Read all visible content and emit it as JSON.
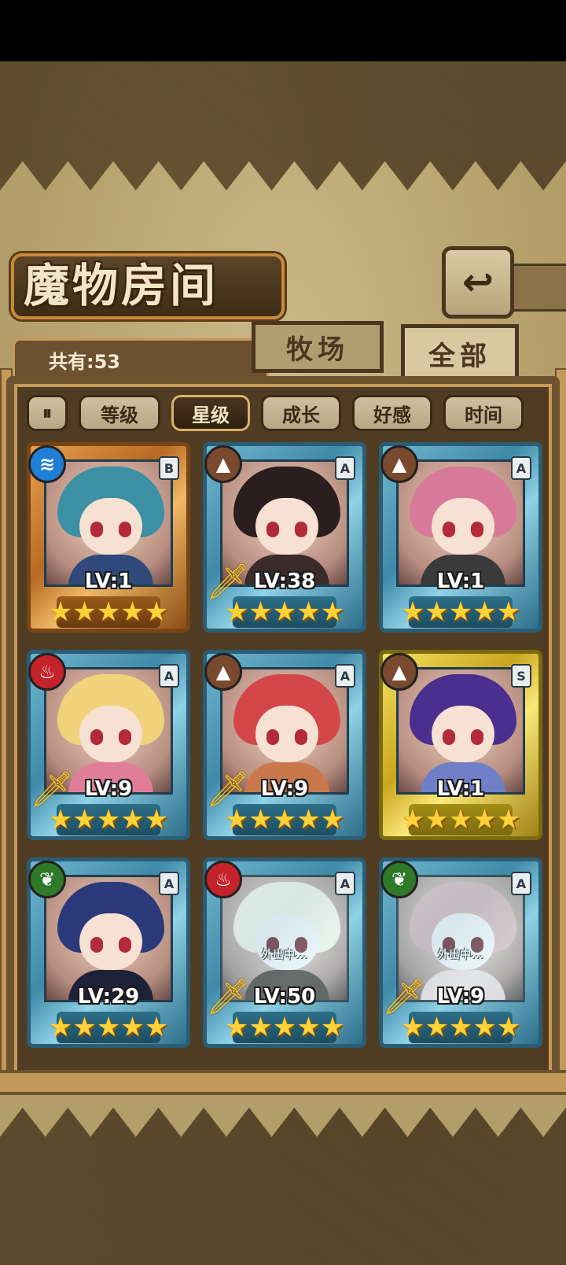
{
  "header": {
    "title": "魔物房间",
    "back_icon": "back-arrow-icon"
  },
  "summary": {
    "count_label": "共有:53"
  },
  "tabs": [
    {
      "label": "牧场",
      "active": false
    },
    {
      "label": "全部",
      "active": true
    }
  ],
  "filters": {
    "toggle_icon": "sort-toggle-icon",
    "buttons": [
      {
        "label": "等级",
        "selected": false
      },
      {
        "label": "星级",
        "selected": true
      },
      {
        "label": "成长",
        "selected": false
      },
      {
        "label": "好感",
        "selected": false
      },
      {
        "label": "时间",
        "selected": false
      }
    ]
  },
  "monsters": [
    {
      "level": "LV:1",
      "rank": "B",
      "element": "water",
      "element_color": "#1f7fd6",
      "frame": "orange",
      "stars": 5,
      "weapon": false,
      "away": false,
      "hair": "#3d8fa3",
      "outfit": "#2f4a7a"
    },
    {
      "level": "LV:38",
      "rank": "A",
      "element": "earth",
      "element_color": "#7a4a2e",
      "frame": "blue",
      "stars": 5,
      "weapon": true,
      "away": false,
      "hair": "#2a1e1e",
      "outfit": "#3b2a2a"
    },
    {
      "level": "LV:1",
      "rank": "A",
      "element": "earth",
      "element_color": "#7a4a2e",
      "frame": "blue",
      "stars": 5,
      "weapon": false,
      "away": false,
      "hair": "#d77a9a",
      "outfit": "#3a3a3a"
    },
    {
      "level": "LV:9",
      "rank": "A",
      "element": "fire",
      "element_color": "#c5232b",
      "frame": "blue",
      "stars": 5,
      "weapon": true,
      "away": false,
      "hair": "#f0d37a",
      "outfit": "#e07e9a"
    },
    {
      "level": "LV:9",
      "rank": "A",
      "element": "earth",
      "element_color": "#7a4a2e",
      "frame": "blue",
      "stars": 5,
      "weapon": true,
      "away": false,
      "hair": "#d3474a",
      "outfit": "#c8784a"
    },
    {
      "level": "LV:1",
      "rank": "S",
      "element": "earth",
      "element_color": "#7a4a2e",
      "frame": "gold",
      "stars": 5,
      "weapon": false,
      "away": false,
      "hair": "#4a2f8e",
      "outfit": "#6f7fc8"
    },
    {
      "level": "LV:29",
      "rank": "A",
      "element": "nature",
      "element_color": "#2f7a2a",
      "frame": "blue",
      "stars": 5,
      "weapon": false,
      "away": false,
      "hair": "#2a3a7a",
      "outfit": "#1e2238"
    },
    {
      "level": "LV:50",
      "rank": "A",
      "element": "fire",
      "element_color": "#c5232b",
      "frame": "blue",
      "stars": 5,
      "weapon": true,
      "away": true,
      "away_label": "外出中...",
      "hair": "#e8dcc0",
      "outfit": "#5a4a3a"
    },
    {
      "level": "LV:9",
      "rank": "A",
      "element": "nature",
      "element_color": "#2f7a2a",
      "frame": "blue",
      "stars": 5,
      "weapon": true,
      "away": true,
      "away_label": "外出中...",
      "hair": "#e6a6a6",
      "outfit": "#e8c8c0"
    }
  ]
}
